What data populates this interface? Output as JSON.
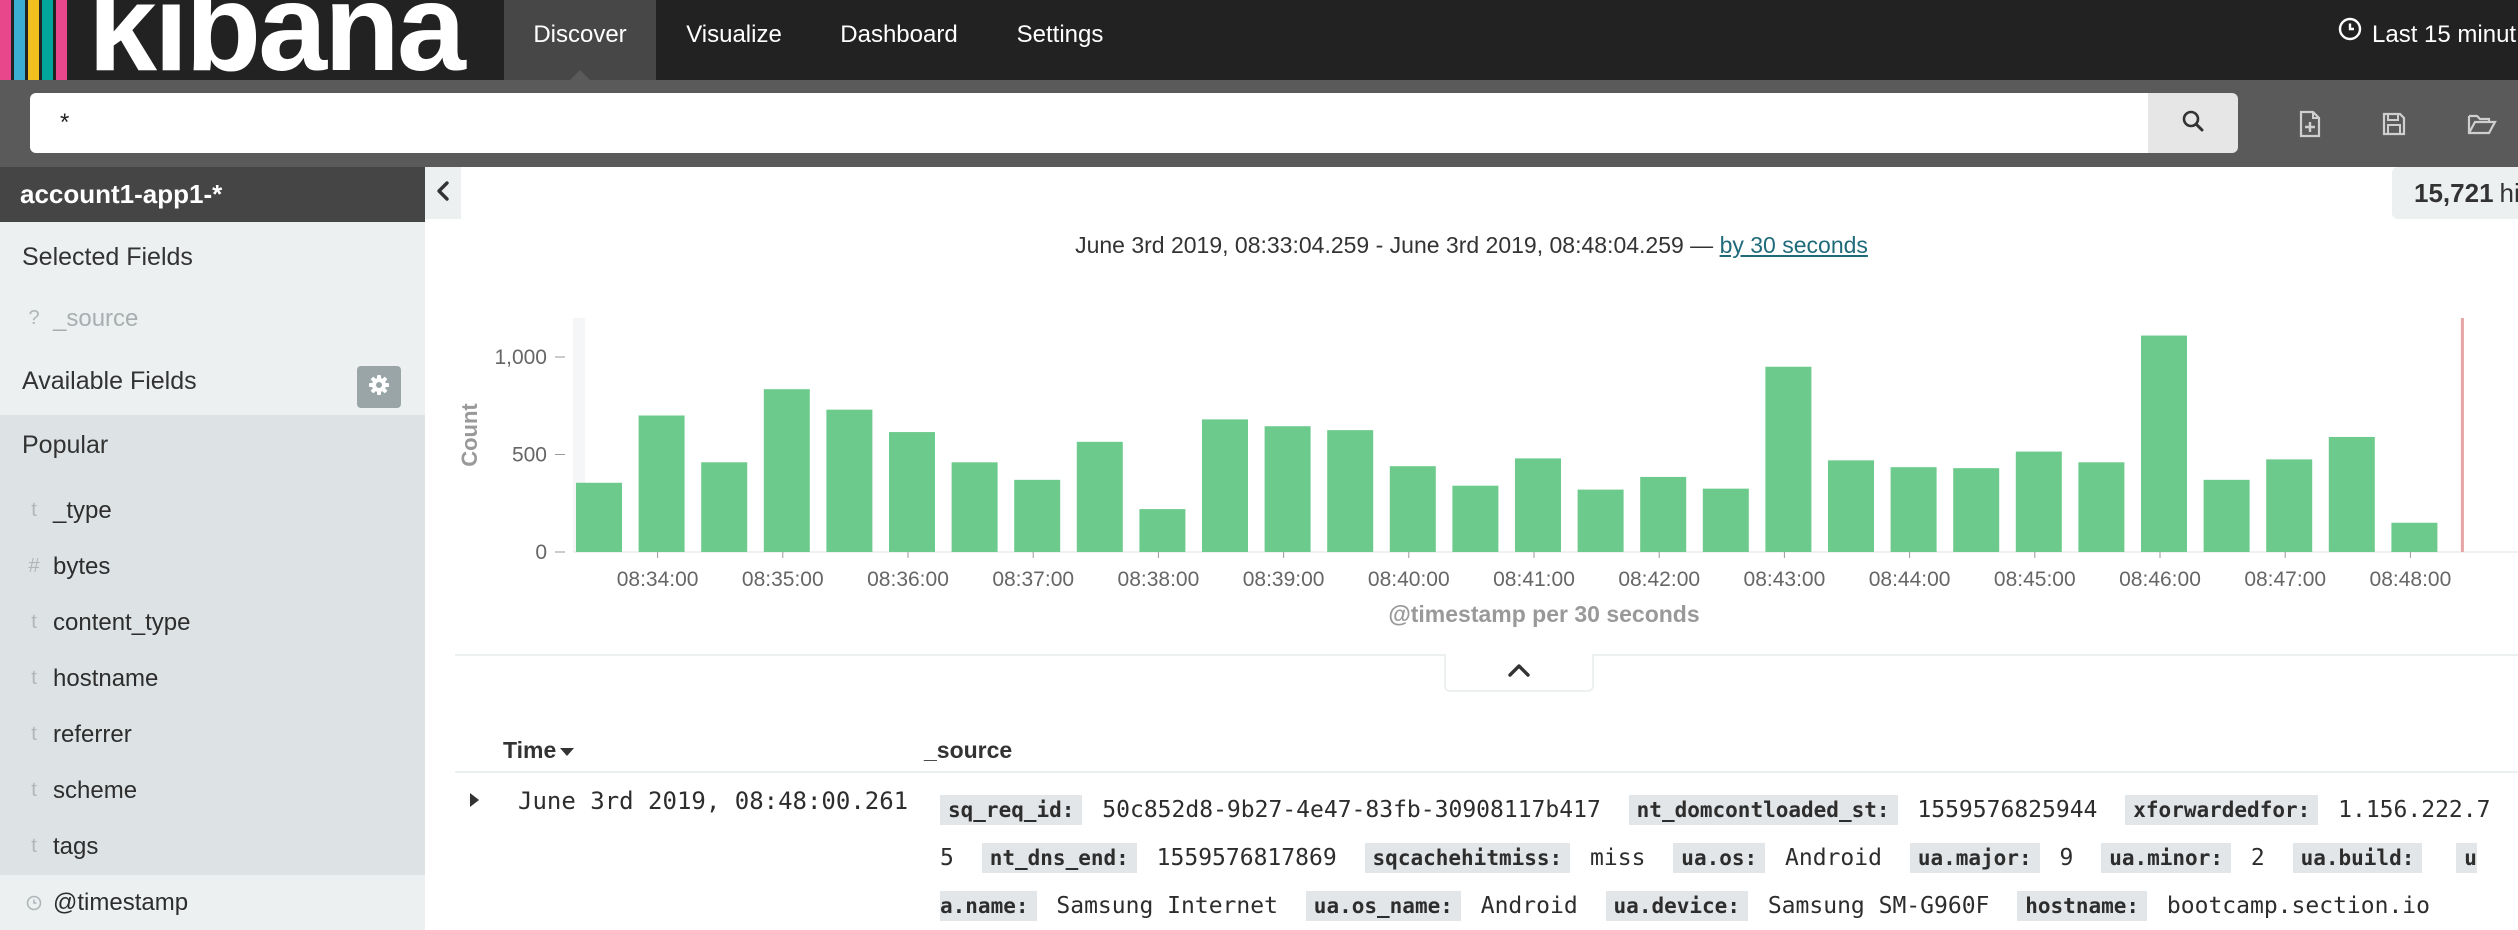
{
  "app": {
    "logo_text": "kibana",
    "logo_colors": [
      "#e8488b",
      "#3caed2",
      "#f2c01e",
      "#00a69b",
      "#e8488b"
    ]
  },
  "nav": {
    "items": [
      {
        "label": "Discover",
        "active": true
      },
      {
        "label": "Visualize",
        "active": false
      },
      {
        "label": "Dashboard",
        "active": false
      },
      {
        "label": "Settings",
        "active": false
      }
    ],
    "time_picker": "Last 15 minut"
  },
  "search": {
    "query": "*"
  },
  "toolbar": {
    "icons": [
      "new-search-icon",
      "save-icon",
      "open-icon"
    ]
  },
  "sidebar": {
    "index_pattern": "account1-app1-*",
    "selected_heading": "Selected Fields",
    "selected_fields": [
      {
        "type": "?",
        "name": "_source"
      }
    ],
    "available_heading": "Available Fields",
    "popular_heading": "Popular",
    "popular_fields": [
      {
        "type": "t",
        "name": "_type"
      },
      {
        "type": "#",
        "name": "bytes"
      },
      {
        "type": "t",
        "name": "content_type"
      },
      {
        "type": "t",
        "name": "hostname"
      },
      {
        "type": "t",
        "name": "referrer"
      },
      {
        "type": "t",
        "name": "scheme"
      },
      {
        "type": "t",
        "name": "tags"
      }
    ],
    "other_fields": [
      {
        "type": "clock",
        "name": "@timestamp"
      }
    ]
  },
  "hits": {
    "count": "15,721",
    "suffix": "hi"
  },
  "time_range": {
    "text": "June 3rd 2019, 08:33:04.259 - June 3rd 2019, 08:48:04.259 — ",
    "interval_link": "by 30 seconds"
  },
  "chart_data": {
    "type": "bar",
    "bar_color": "#6ccb8c",
    "xlabel": "@timestamp per 30 seconds",
    "ylabel": "Count",
    "ylim": [
      0,
      1200
    ],
    "yticks": [
      0,
      500,
      1000
    ],
    "ytick_labels": [
      "0",
      "500",
      "1,000"
    ],
    "x_tick_labels": [
      "08:34:00",
      "08:35:00",
      "08:36:00",
      "08:37:00",
      "08:38:00",
      "08:39:00",
      "08:40:00",
      "08:41:00",
      "08:42:00",
      "08:43:00",
      "08:44:00",
      "08:45:00",
      "08:46:00",
      "08:47:00",
      "08:48:00"
    ],
    "values": [
      355,
      700,
      460,
      835,
      730,
      615,
      460,
      370,
      565,
      220,
      680,
      645,
      625,
      440,
      340,
      480,
      320,
      385,
      325,
      950,
      470,
      435,
      430,
      515,
      460,
      1110,
      370,
      475,
      590,
      150
    ],
    "grid": false,
    "current_time_marker": true
  },
  "table": {
    "time_header": "Time",
    "source_header": "_source",
    "rows": [
      {
        "time": "June 3rd 2019, 08:48:00.261",
        "fields": [
          {
            "key": "sq_req_id:",
            "value": "50c852d8-9b27-4e47-83fb-30908117b417"
          },
          {
            "key": "nt_domcontloaded_st:",
            "value": "1559576825944"
          },
          {
            "key": "xforwardedfor:",
            "value": "1.156.222.75"
          },
          {
            "key": "nt_dns_end:",
            "value": "1559576817869"
          },
          {
            "key": "sqcachehitmiss:",
            "value": "miss"
          },
          {
            "key": "ua.os:",
            "value": "Android"
          },
          {
            "key": "ua.major:",
            "value": "9"
          },
          {
            "key": "ua.minor:",
            "value": "2"
          },
          {
            "key": "ua.build:",
            "value": ""
          },
          {
            "key": "ua.name:",
            "value": "Samsung Internet"
          },
          {
            "key": "ua.os_name:",
            "value": "Android"
          },
          {
            "key": "ua.device:",
            "value": "Samsung SM-G960F"
          },
          {
            "key": "hostname:",
            "value": "bootcamp.section.io"
          }
        ]
      }
    ]
  }
}
